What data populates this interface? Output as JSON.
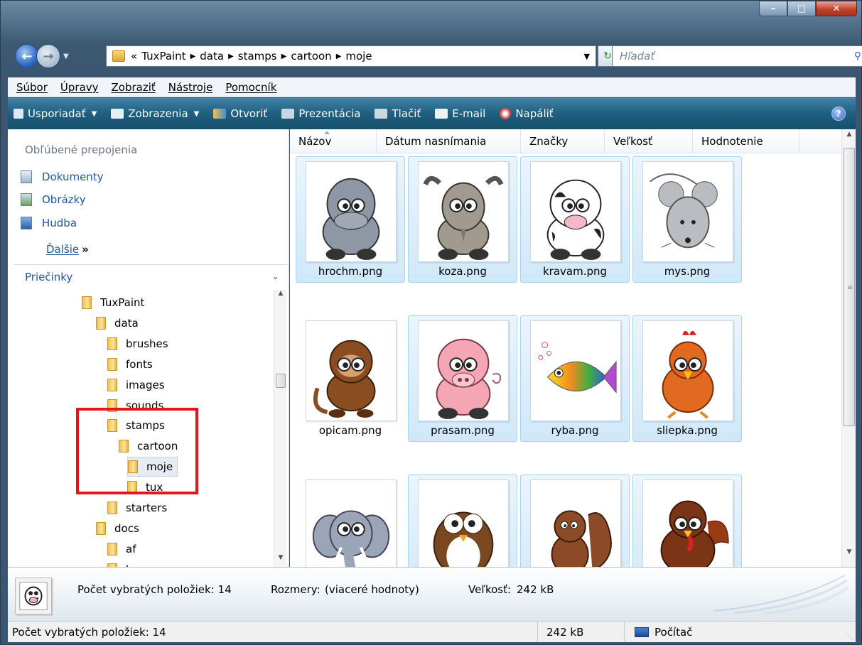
{
  "nav": {
    "path": [
      "«",
      "TuxPaint",
      "data",
      "stamps",
      "cartoon",
      "moje"
    ],
    "search_placeholder": "Hľadať"
  },
  "menu": [
    "Súbor",
    "Úpravy",
    "Zobraziť",
    "Nástroje",
    "Pomocník"
  ],
  "toolbar": {
    "organize": "Usporiadať",
    "views": "Zobrazenia",
    "open": "Otvoriť",
    "slideshow": "Prezentácia",
    "print": "Tlačiť",
    "email": "E-mail",
    "burn": "Napáliť"
  },
  "favorites": {
    "title": "Obľúbené prepojenia",
    "links": [
      "Dokumenty",
      "Obrázky",
      "Hudba"
    ],
    "more": "Ďalšie",
    "more_arrow": "»"
  },
  "folders": {
    "title": "Priečinky",
    "tree": [
      {
        "label": "TuxPaint",
        "level": 0
      },
      {
        "label": "data",
        "level": 1
      },
      {
        "label": "brushes",
        "level": 2
      },
      {
        "label": "fonts",
        "level": 2
      },
      {
        "label": "images",
        "level": 2
      },
      {
        "label": "sounds",
        "level": 2
      },
      {
        "label": "stamps",
        "level": 2
      },
      {
        "label": "cartoon",
        "level": 3
      },
      {
        "label": "moje",
        "level": 4,
        "selected": true
      },
      {
        "label": "tux",
        "level": 4
      },
      {
        "label": "starters",
        "level": 2
      },
      {
        "label": "docs",
        "level": 1
      },
      {
        "label": "af",
        "level": 2
      },
      {
        "label": "be",
        "level": 2
      }
    ]
  },
  "columns": [
    "Názov",
    "Dátum nasnímania",
    "Značky",
    "Veľkosť",
    "Hodnotenie"
  ],
  "files": [
    {
      "name": "hrochm.png",
      "animal": "hippo",
      "color": "#8d97a6"
    },
    {
      "name": "koza.png",
      "animal": "goat",
      "color": "#a29a8e"
    },
    {
      "name": "kravam.png",
      "animal": "cow",
      "color": "#ffffff"
    },
    {
      "name": "mys.png",
      "animal": "mouse",
      "color": "#b9bcc0"
    },
    {
      "name": "opicam.png",
      "animal": "monkey",
      "color": "#8a4d22",
      "selected": false
    },
    {
      "name": "prasam.png",
      "animal": "pig",
      "color": "#f4a6b4"
    },
    {
      "name": "ryba.png",
      "animal": "fish",
      "color": "#f0c020"
    },
    {
      "name": "sliepka.png",
      "animal": "chicken",
      "color": "#e06a20"
    },
    {
      "name": "",
      "animal": "elephant",
      "color": "#9aa5b8",
      "selected": false
    },
    {
      "name": "",
      "animal": "owl",
      "color": "#7a4820"
    },
    {
      "name": "",
      "animal": "squirrel",
      "color": "#8c4a26"
    },
    {
      "name": "",
      "animal": "turkey",
      "color": "#7a3416"
    }
  ],
  "details": {
    "selected_count_label": "Počet vybratých položiek: 14",
    "dimensions_label": "Rozmery:",
    "dimensions_value": "(viaceré hodnoty)",
    "size_label": "Veľkosť:",
    "size_value": "242 kB"
  },
  "status": {
    "selected": "Počet vybratých položiek: 14",
    "size": "242 kB",
    "location": "Počítač"
  }
}
